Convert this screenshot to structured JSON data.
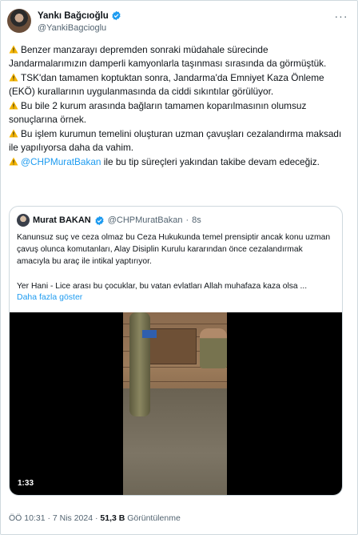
{
  "author": {
    "display_name": "Yankı Bağcıoğlu",
    "handle": "@YankiBagcioglu",
    "verified": true
  },
  "tweet": {
    "paragraphs": [
      "Benzer manzarayı depremden sonraki müdahale sürecinde Jandarmalarımızın damperli kamyonlarla taşınması sırasında da görmüştük.",
      "TSK'dan tamamen koptuktan sonra, Jandarma'da Emniyet Kaza Önleme (EKÖ) kurallarının uygulanmasında da ciddi sıkıntılar görülüyor.",
      "Bu bile 2 kurum arasında bağların tamamen koparılmasının olumsuz sonuçlarına örnek.",
      "Bu işlem kurumun temelini oluşturan uzman çavuşları cezalandırma maksadı ile yapılıyorsa daha da vahim."
    ],
    "last_mention": "@CHPMuratBakan",
    "last_text": " ile bu tip süreçleri yakından takibe devam edeceğiz."
  },
  "quote": {
    "display_name": "Murat BAKAN",
    "handle": "@CHPMuratBakan",
    "separator": "·",
    "time_ago": "8s",
    "text_1": "Kanunsuz suç ve ceza olmaz bu Ceza Hukukunda temel prensiptir ancak konu uzman çavuş olunca komutanları, Alay Disiplin Kurulu kararından önce cezalandırmak amacıyla bu araç ile intikal yaptırıyor.",
    "text_2": "Yer Hani - Lice arası bu çocuklar, bu vatan evlatları Allah muhafaza kaza olsa ...",
    "show_more": "Daha fazla göster",
    "video_duration": "1:33"
  },
  "meta": {
    "time_date": "ÖÖ 10:31 · 7 Nis 2024 · ",
    "views_count": "51,3 B",
    "views_label": " Görüntülenme"
  },
  "icons": {
    "verified": "verified-badge-icon",
    "warning": "warning-icon",
    "more": "more-icon"
  },
  "colors": {
    "accent": "#1d9bf0",
    "text": "#0f1419",
    "muted": "#536471",
    "border": "#cfd9de",
    "warning": "#f4b400"
  }
}
